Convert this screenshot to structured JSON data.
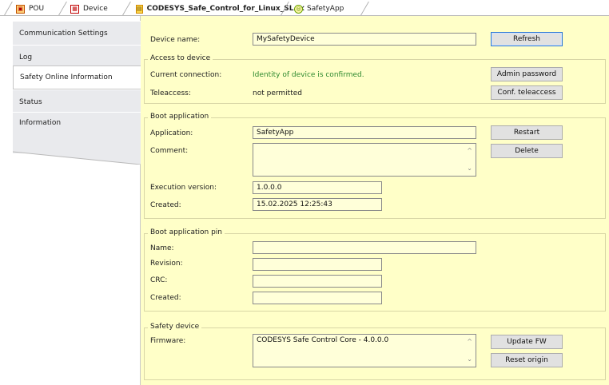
{
  "tabs": {
    "pou": "POU",
    "device": "Device",
    "active": "CODESYS_Safe_Control_for_Linux_SL",
    "app": "SafetyApp",
    "close": "✕"
  },
  "nav": {
    "items": [
      {
        "label": "Communication Settings"
      },
      {
        "label": "Log"
      },
      {
        "label": "Safety Online Information"
      },
      {
        "label": "Status"
      },
      {
        "label": "Information"
      }
    ]
  },
  "top": {
    "device_name_label": "Device name:",
    "device_name_value": "MySafetyDevice",
    "refresh": "Refresh"
  },
  "access": {
    "title": "Access to device",
    "current_label": "Current connection:",
    "current_value": "Identity of device is confirmed.",
    "admin_btn": "Admin password",
    "tele_label": "Teleaccess:",
    "tele_value": "not permitted",
    "tele_btn": "Conf. teleaccess"
  },
  "boot": {
    "title": "Boot application",
    "app_label": "Application:",
    "app_value": "SafetyApp",
    "restart": "Restart",
    "comment_label": "Comment:",
    "comment_value": "",
    "delete": "Delete",
    "exec_label": "Execution version:",
    "exec_value": "1.0.0.0",
    "created_label": "Created:",
    "created_value": "15.02.2025 12:25:43"
  },
  "pin": {
    "title": "Boot application pin",
    "name_label": "Name:",
    "name_value": "",
    "revision_label": "Revision:",
    "revision_value": "",
    "crc_label": "CRC:",
    "crc_value": "",
    "created_label": "Created:",
    "created_value": ""
  },
  "safety": {
    "title": "Safety device",
    "fw_label": "Firmware:",
    "fw_value": "CODESYS Safe Control Core - 4.0.0.0",
    "update_btn": "Update FW",
    "reset_btn": "Reset origin"
  },
  "colors": {
    "panel_bg": "#ffffc8",
    "ok_text": "#2f8a2f",
    "primary_border": "#2f78d1"
  }
}
